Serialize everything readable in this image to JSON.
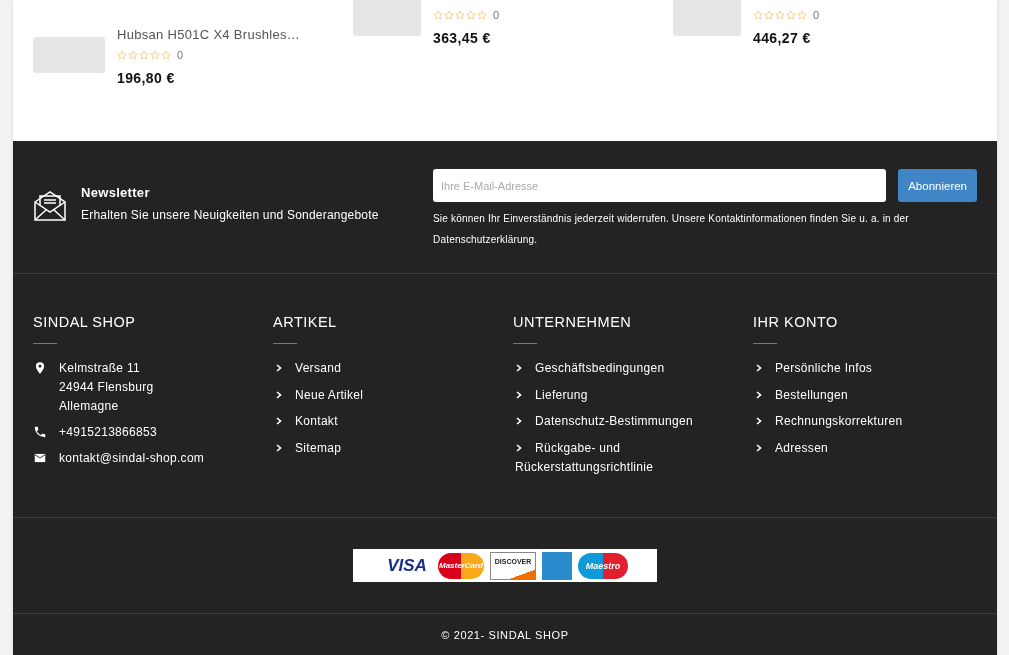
{
  "products": [
    {
      "title": "Hubsan H501C X4 Brushles…",
      "stars": 0,
      "rating_count": "0",
      "price": "196,80 €"
    },
    {
      "stars": 0,
      "rating_count": "0",
      "price": "363,45 €"
    },
    {
      "stars": 0,
      "rating_count": "0",
      "price": "446,27 €"
    }
  ],
  "newsletter": {
    "title": "Newsletter",
    "subtitle": "Erhalten Sie unsere Neuigkeiten und Sonderangebote",
    "email": {
      "placeholder": "Ihre E-Mail-Adresse"
    },
    "button": "Abonnieren",
    "notice": "Sie können Ihr Einverständnis jederzeit widerrufen. Unsere Kontaktinformationen finden Sie u. a. in der Datenschutzerklärung."
  },
  "columns": [
    {
      "heading": "SINDAL SHOP",
      "kind": "contact",
      "items": [
        {
          "kind": "address",
          "lines": [
            "Kelmstraße 11",
            "24944 Flensburg",
            "Allemagne"
          ]
        },
        {
          "kind": "phone",
          "lines": [
            "+4915213866853"
          ]
        },
        {
          "kind": "email",
          "lines": [
            "kontakt@sindal-shop.com"
          ]
        }
      ]
    },
    {
      "heading": "ARTIKEL",
      "kind": "links",
      "items": [
        "Versand",
        "Neue Artikel",
        "Kontakt",
        "Sitemap"
      ]
    },
    {
      "heading": "UNTERNEHMEN",
      "kind": "links",
      "items": [
        "Geschäftsbedingungen",
        "Lieferung",
        "Datenschutz-Bestimmungen",
        "Rückgabe- und Rückerstattungsrichtlinie"
      ]
    },
    {
      "heading": "IHR KONTO",
      "kind": "links",
      "items": [
        "Persönliche Infos",
        "Bestellungen",
        "Rechnungskorrekturen",
        "Adressen"
      ]
    }
  ],
  "payment_logos": [
    "VISA",
    "MasterCard",
    "DISCOVER",
    "Maestro"
  ],
  "copyright": "© 2021- SINDAL SHOP"
}
